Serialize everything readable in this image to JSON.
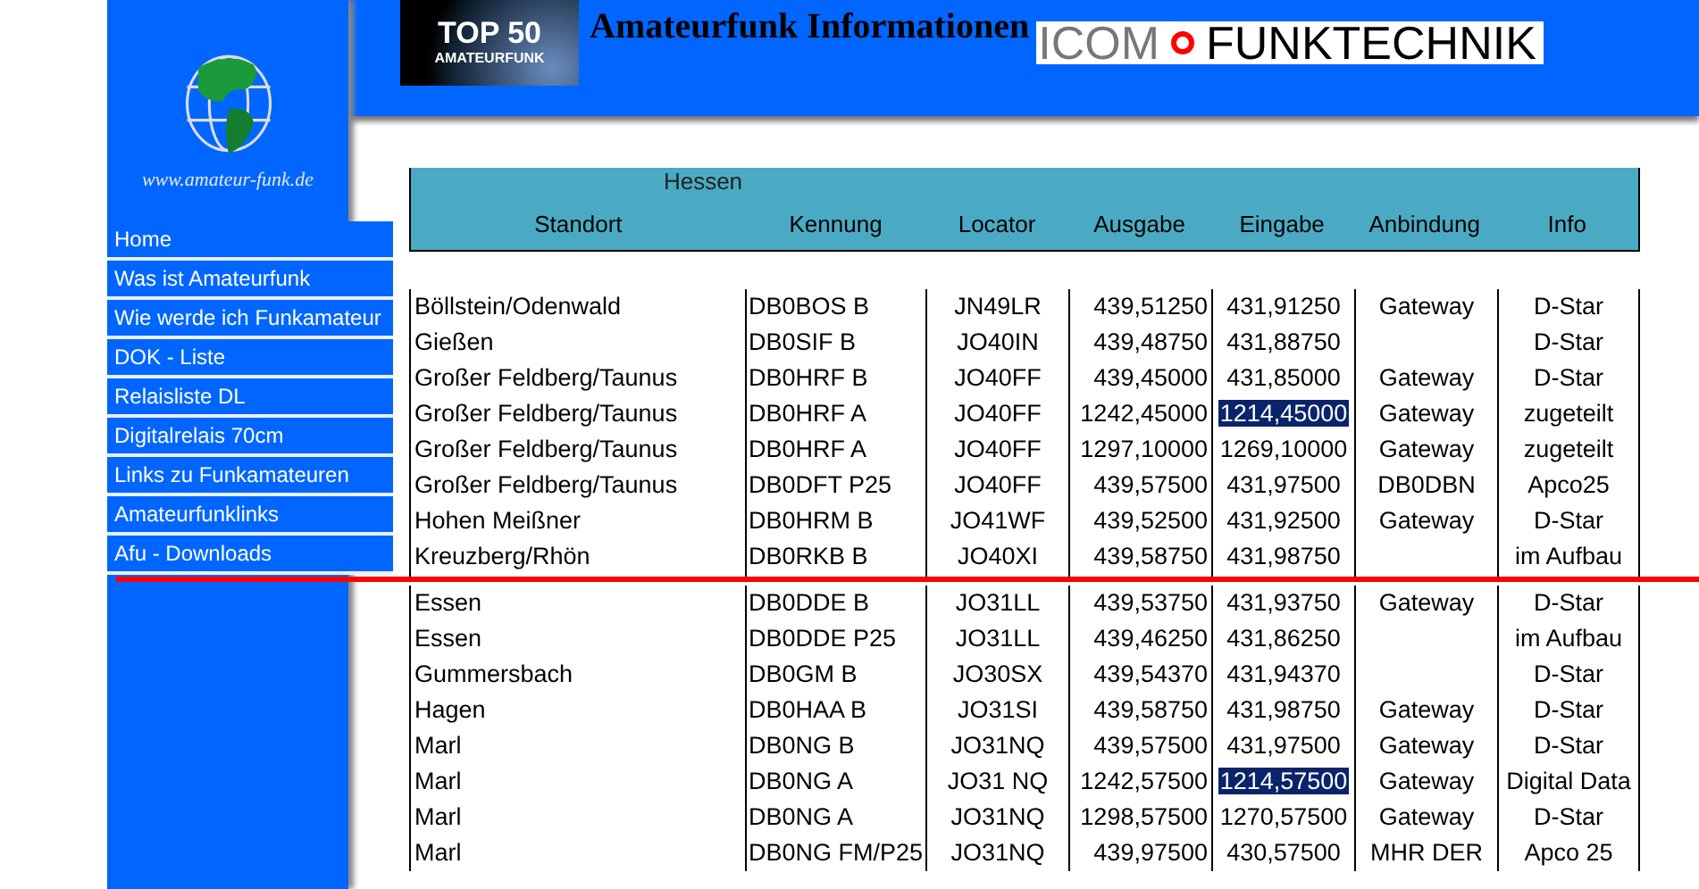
{
  "logo": {
    "url": "www.amateur-funk.de"
  },
  "top50_badge": {
    "line_1": "TOP 50",
    "line_2": "AMATEURFUNK"
  },
  "header": {
    "title": "Amateurfunk Informationen"
  },
  "banner": {
    "brand": "ICOM",
    "name": "FUNKTECHNIK"
  },
  "menu": [
    {
      "label": "Home"
    },
    {
      "label": "Was ist Amateurfunk"
    },
    {
      "label": "Wie werde ich Funkamateur"
    },
    {
      "label": "DOK - Liste"
    },
    {
      "label": "Relaisliste DL"
    },
    {
      "label": "Digitalrelais 70cm"
    },
    {
      "label": "Links zu Funkamateuren"
    },
    {
      "label": "Amateurfunklinks"
    },
    {
      "label": "Afu - Downloads"
    }
  ],
  "table": {
    "region": "Hessen",
    "columns": [
      "Standort",
      "Kennung",
      "Locator",
      "Ausgabe",
      "Eingabe",
      "Anbindung",
      "Info"
    ],
    "sections": [
      {
        "rows": [
          {
            "standort": "Böllstein/Odenwald",
            "kennung": "DB0BOS B",
            "locator": "JN49LR",
            "ausgabe": "439,51250",
            "eingabe": "431,91250",
            "anbindung": "Gateway",
            "info": "D-Star",
            "highlighted": false
          },
          {
            "standort": "Gießen",
            "kennung": "DB0SIF B",
            "locator": "JO40IN",
            "ausgabe": "439,48750",
            "eingabe": "431,88750",
            "info": "D-Star",
            "highlighted": false
          },
          {
            "standort": "Großer Feldberg/Taunus",
            "kennung": "DB0HRF B",
            "locator": "JO40FF",
            "ausgabe": "439,45000",
            "eingabe": "431,85000",
            "anbindung": "Gateway",
            "info": "D-Star",
            "highlighted": false
          },
          {
            "standort": "Großer Feldberg/Taunus",
            "kennung": "DB0HRF A",
            "locator": "JO40FF",
            "ausgabe": "1242,45000",
            "eingabe": "1214,45000",
            "anbindung": "Gateway",
            "info": "zugeteilt",
            "highlighted": true
          },
          {
            "standort": "Großer Feldberg/Taunus",
            "kennung": "DB0HRF A",
            "locator": "JO40FF",
            "ausgabe": "1297,10000",
            "eingabe": "1269,10000",
            "anbindung": "Gateway",
            "info": "zugeteilt",
            "highlighted": false
          },
          {
            "standort": "Großer Feldberg/Taunus",
            "kennung": "DB0DFT P25",
            "locator": "JO40FF",
            "ausgabe": "439,57500",
            "eingabe": "431,97500",
            "anbindung": "DB0DBN",
            "info": "Apco25",
            "highlighted": false
          },
          {
            "standort": "Hohen Meißner",
            "kennung": "DB0HRM B",
            "locator": "JO41WF",
            "ausgabe": "439,52500",
            "eingabe": "431,92500",
            "anbindung": "Gateway",
            "info": "D-Star",
            "highlighted": false
          },
          {
            "standort": "Kreuzberg/Rhön",
            "kennung": "DB0RKB B",
            "locator": "JO40XI",
            "ausgabe": "439,58750",
            "eingabe": "431,98750",
            "info": "im Aufbau",
            "highlighted": false
          }
        ]
      },
      {
        "rows": [
          {
            "standort": "Essen",
            "kennung": "DB0DDE  B",
            "locator": "JO31LL",
            "ausgabe": "439,53750",
            "eingabe": "431,93750",
            "anbindung": "Gateway",
            "info": "D-Star",
            "highlighted": false
          },
          {
            "standort": "Essen",
            "kennung": "DB0DDE P25",
            "locator": "JO31LL",
            "ausgabe": "439,46250",
            "eingabe": "431,86250",
            "info": "im Aufbau",
            "highlighted": false
          },
          {
            "standort": "Gummersbach",
            "kennung": "DB0GM B",
            "locator": "JO30SX",
            "ausgabe": "439,54370",
            "eingabe": "431,94370",
            "info": "D-Star",
            "highlighted": false
          },
          {
            "standort": "Hagen",
            "kennung": "DB0HAA B",
            "locator": "JO31SI",
            "ausgabe": "439,58750",
            "eingabe": "431,98750",
            "anbindung": "Gateway",
            "info": "D-Star",
            "highlighted": false
          },
          {
            "standort": "Marl",
            "kennung": "DB0NG B",
            "locator": "JO31NQ",
            "ausgabe": "439,57500",
            "eingabe": "431,97500",
            "anbindung": "Gateway",
            "info": "D-Star",
            "highlighted": false
          },
          {
            "standort": "Marl",
            "kennung": "DB0NG A",
            "locator": "JO31 NQ",
            "ausgabe": "1242,57500",
            "eingabe": "1214,57500",
            "anbindung": "Gateway",
            "info": "Digital Data",
            "highlighted": true
          },
          {
            "standort": "Marl",
            "kennung": "DB0NG A",
            "locator": "JO31NQ",
            "ausgabe": "1298,57500",
            "eingabe": "1270,57500",
            "anbindung": "Gateway",
            "info": "D-Star",
            "highlighted": false
          },
          {
            "standort": "Marl",
            "kennung": "DB0NG FM/P25",
            "locator": "JO31NQ",
            "ausgabe": "439,97500",
            "eingabe": "430,57500",
            "anbindung": "MHR DER",
            "info": "Apco 25",
            "highlighted": false
          }
        ]
      }
    ]
  }
}
